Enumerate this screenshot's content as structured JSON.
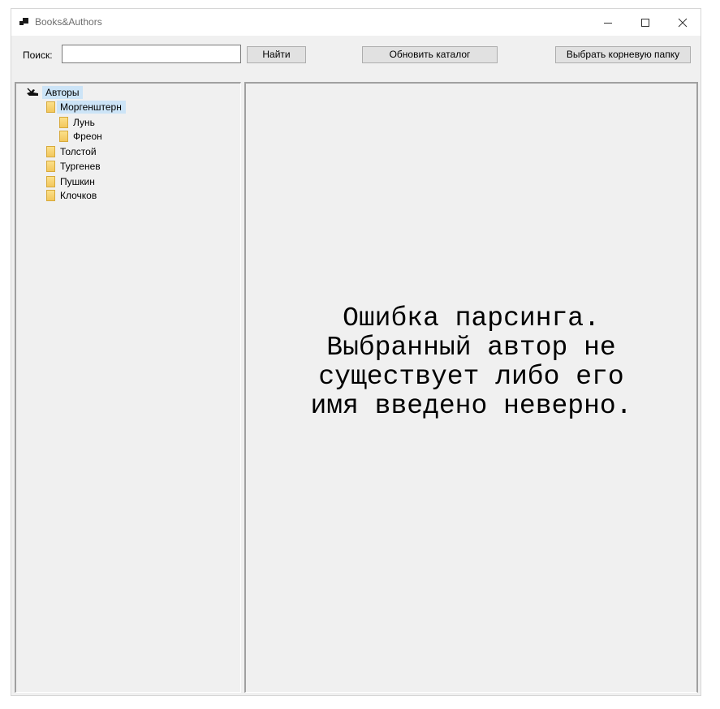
{
  "window": {
    "title": "Books&Authors"
  },
  "toolbar": {
    "search_label": "Поиск:",
    "search_value": "",
    "find_button": "Найти",
    "refresh_button": "Обновить каталог",
    "choose_root_button": "Выбрать корневую папку"
  },
  "tree": {
    "root": {
      "label": "Авторы",
      "icon": "pen-hand-icon",
      "selected": true
    },
    "authors": [
      {
        "label": "Моргенштерн",
        "selected": true,
        "children": [
          "Лунь",
          "Фреон"
        ]
      },
      {
        "label": "Толстой"
      },
      {
        "label": "Тургенев"
      },
      {
        "label": "Пушкин"
      },
      {
        "label": "Клочков"
      }
    ]
  },
  "content": {
    "error_message": "Ошибка парсинга.\nВыбранный автор не\nсуществует либо его\nимя введено неверно."
  },
  "colors": {
    "window_bg": "#f0f0f0",
    "selection": "#cce4f7",
    "folder": "#f3c75c",
    "button": "#e1e1e1"
  }
}
